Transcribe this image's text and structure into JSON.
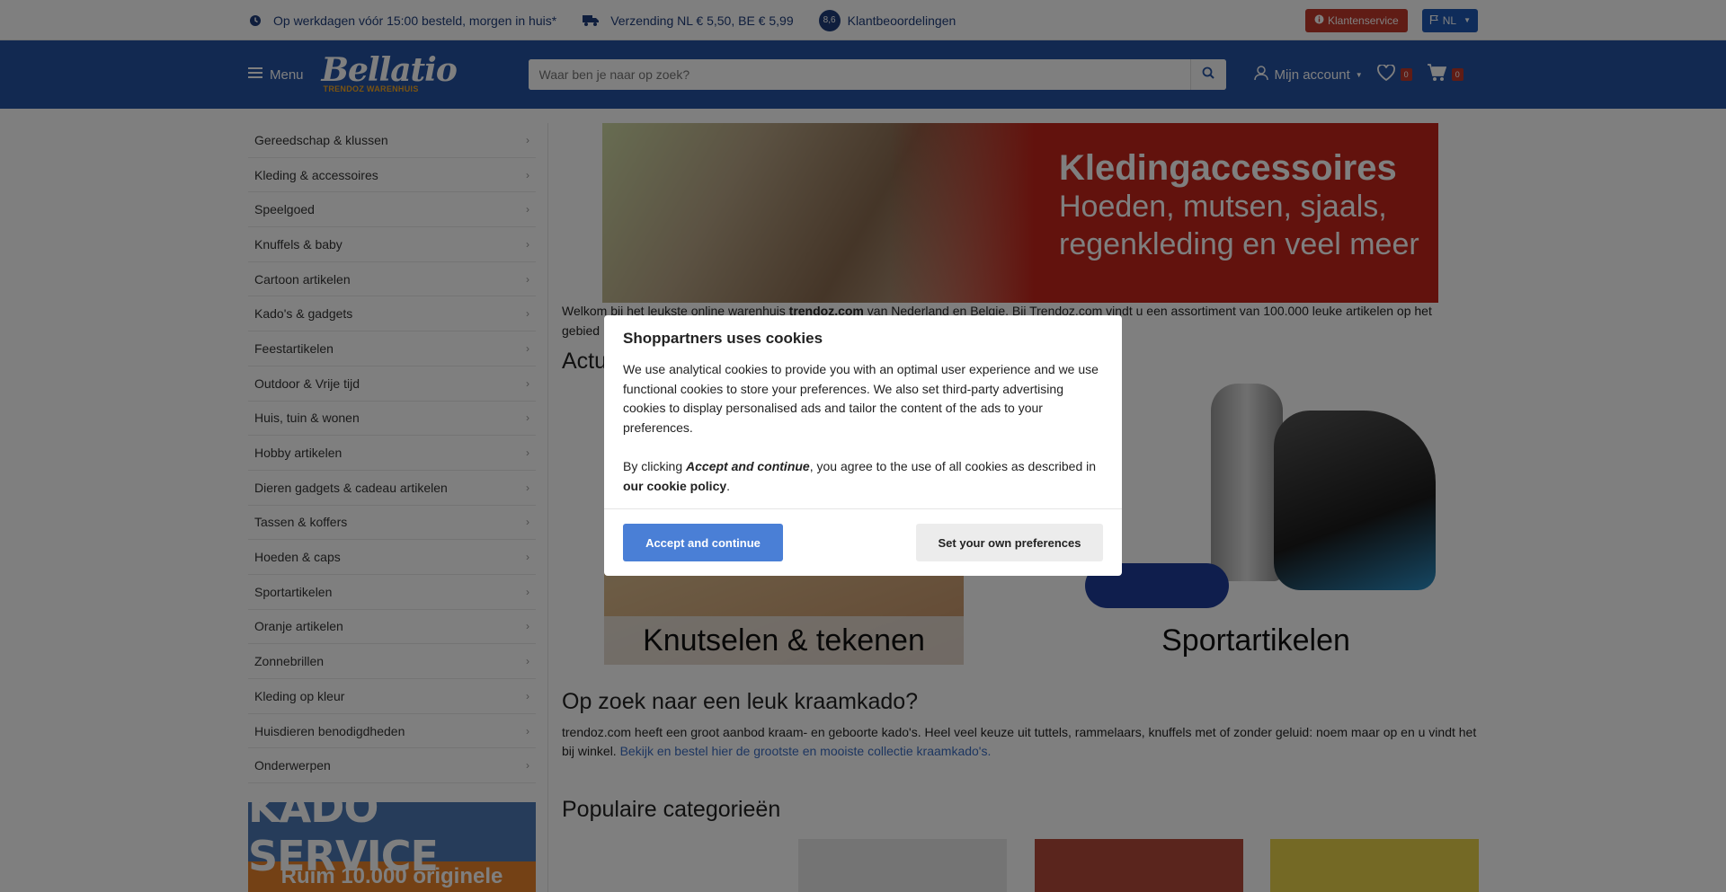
{
  "topbar": {
    "usp_delivery": "Op werkdagen vóór 15:00 besteld, morgen in huis*",
    "usp_shipping": "Verzending NL € 5,50, BE € 5,99",
    "rating_score": "8,6",
    "usp_reviews": "Klantbeoordelingen",
    "service_label": "Klantenservice",
    "lang_label": "NL"
  },
  "header": {
    "menu_label": "Menu",
    "logo_text": "Bellatio",
    "logo_tagline": "TRENDOZ WARENHUIS",
    "search_placeholder": "Waar ben je naar op zoek?",
    "account_label": "Mijn account",
    "wishlist_count": "0",
    "cart_count": "0"
  },
  "sidebar": {
    "categories": [
      "Gereedschap & klussen",
      "Kleding & accessoires",
      "Speelgoed",
      "Knuffels & baby",
      "Cartoon artikelen",
      "Kado's & gadgets",
      "Feestartikelen",
      "Outdoor & Vrije tijd",
      "Huis, tuin & wonen",
      "Hobby artikelen",
      "Dieren gadgets & cadeau artikelen",
      "Tassen & koffers",
      "Hoeden & caps",
      "Sportartikelen",
      "Oranje artikelen",
      "Zonnebrillen",
      "Kleding op kleur",
      "Huisdieren benodigdheden",
      "Onderwerpen"
    ],
    "banner_top": "KADO SERVICE",
    "banner_bottom": "Ruim 10.000 originele"
  },
  "main": {
    "hero_title": "Kledingaccessoires",
    "hero_subtitle_1": "Hoeden, mutsen, sjaals,",
    "hero_subtitle_2": "regenkleding en veel meer",
    "intro_pre": "Welkom bij het leukste online warenhuis ",
    "intro_brand": "trendoz.com",
    "intro_post": " van Nederland en Belgie. Bij Trendoz.com vindt u een assortiment van 100.000 leuke artikelen op het",
    "intro_line2": "gebied",
    "actual_title_partial": "Actu",
    "tile_1_label": "Knutselen & tekenen",
    "tile_2_label": "Sportartikelen",
    "kraam_title": "Op zoek naar een leuk kraamkado?",
    "kraam_text": "trendoz.com heeft een groot aanbod kraam- en geboorte kado's. Heel veel keuze uit tuttels, rammelaars, knuffels met of zonder geluid: noem maar op en u vindt het bij winkel. ",
    "kraam_link": "Bekijk en bestel hier de grootste en mooiste collectie kraamkado's.",
    "popular_title": "Populaire categorieën"
  },
  "cookie_modal": {
    "title": "Shoppartners uses cookies",
    "body_1": "We use analytical cookies to provide you with an optimal user experience and we use functional cookies to store your preferences. We also set third-party advertising cookies to display personalised ads and tailor the content of the ads to your preferences.",
    "body_2_pre": "By clicking ",
    "body_2_emph": "Accept and continue",
    "body_2_mid": ", you agree to the use of all cookies as described in ",
    "body_2_link": "our cookie policy",
    "body_2_end": ".",
    "accept_label": "Accept and continue",
    "prefs_label": "Set your own preferences"
  },
  "colors": {
    "header_blue": "#2453a3",
    "accent_red": "#c4251b",
    "accept_blue": "#4a7fd6"
  }
}
